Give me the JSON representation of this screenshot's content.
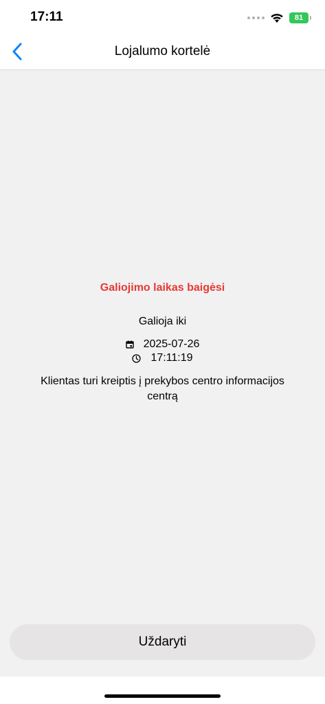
{
  "status_bar": {
    "time": "17:11",
    "battery_level": "81"
  },
  "nav": {
    "title": "Lojalumo kortelė",
    "back_icon": "chevron-left-icon"
  },
  "card": {
    "status_text": "Galiojimo laikas baigėsi",
    "status_color": "#e53935",
    "valid_until_label": "Galioja iki",
    "date": "2025-07-26",
    "time": "17:11:19",
    "message": "Klientas turi kreiptis į prekybos centro informacijos centrą"
  },
  "actions": {
    "close_label": "Uždaryti"
  },
  "colors": {
    "accent": "#0a84ff",
    "battery": "#34c759",
    "background": "#f1f1f1"
  }
}
